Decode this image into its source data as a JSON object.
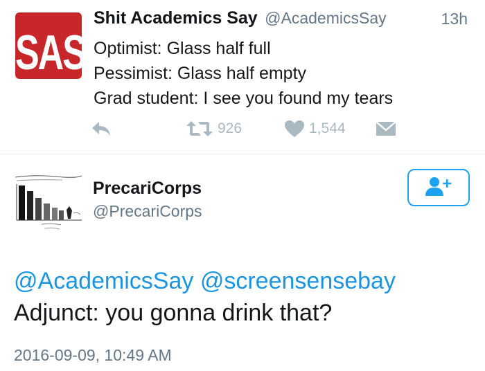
{
  "tweet": {
    "avatar_text": "SAS",
    "author_name": "Shit Academics Say",
    "author_handle": "@AcademicsSay",
    "time_ago": "13h",
    "lines": [
      "Optimist: Glass half full",
      "Pessimist: Glass half empty",
      "Grad student: I see you found my tears"
    ],
    "retweet_count": "926",
    "like_count": "1,544"
  },
  "reply": {
    "author_name": "PrecariCorps",
    "author_handle": "@PrecariCorps",
    "mentions": [
      "@AcademicsSay",
      "@screensensebay"
    ],
    "text": "Adjunct: you gonna drink that?",
    "timestamp": "2016-09-09, 10:49 AM"
  },
  "colors": {
    "avatar_red": "#c8272a",
    "link_blue": "#1b95e0",
    "follow_blue": "#1da1f2",
    "muted_gray": "#657786",
    "action_gray": "#aab8c2"
  },
  "icons": {
    "reply": "reply-arrow-icon",
    "retweet": "retweet-icon",
    "like": "heart-icon",
    "message": "envelope-icon",
    "follow": "add-user-icon"
  }
}
